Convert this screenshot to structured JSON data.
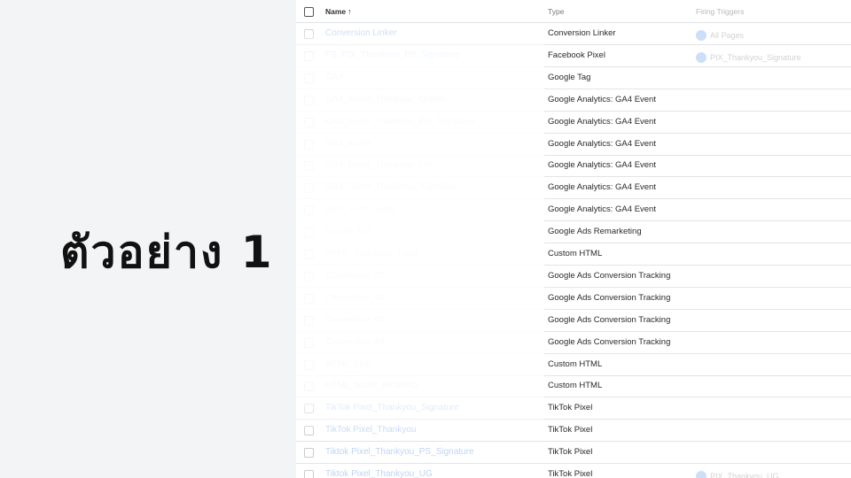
{
  "slide_title": "ตัวอย่าง 1",
  "table": {
    "headers": {
      "name": "Name",
      "sort_icon": "↑",
      "type": "Type",
      "triggers": "Firing Triggers"
    },
    "rows": [
      {
        "name": "Conversion Linker",
        "type": "Conversion Linker",
        "trigger": "All Pages"
      },
      {
        "name": "FB_PIX_Thankyou_PS_Signature",
        "type": "Facebook Pixel",
        "trigger": "PIX_Thankyou_Signature"
      },
      {
        "name": "GA4",
        "type": "Google Tag",
        "trigger": ""
      },
      {
        "name": "GA4_Event_Thankyou_Online",
        "type": "Google Analytics: GA4 Event",
        "trigger": ""
      },
      {
        "name": "GA4_Event_Thankyou_PS_Signature",
        "type": "Google Analytics: GA4 Event",
        "trigger": ""
      },
      {
        "name": "GA4_Event",
        "type": "Google Analytics: GA4 Event",
        "trigger": ""
      },
      {
        "name": "GA4_Event_Thankyou_UG",
        "type": "Google Analytics: GA4 Event",
        "trigger": ""
      },
      {
        "name": "GA4_Event_Thankyou_Signature",
        "type": "Google Analytics: GA4 Event",
        "trigger": ""
      },
      {
        "name": "GA4_Event_Lead",
        "type": "Google Analytics: GA4 Event",
        "trigger": ""
      },
      {
        "name": "Google Ads",
        "type": "Google Ads Remarketing",
        "trigger": ""
      },
      {
        "name": "HTML_Thankyou_Lead",
        "type": "Custom HTML",
        "trigger": ""
      },
      {
        "name": "Conversion_01",
        "type": "Google Ads Conversion Tracking",
        "trigger": ""
      },
      {
        "name": "Conversion_02",
        "type": "Google Ads Conversion Tracking",
        "trigger": ""
      },
      {
        "name": "Conversion_03",
        "type": "Google Ads Conversion Tracking",
        "trigger": ""
      },
      {
        "name": "Conversion_04",
        "type": "Google Ads Conversion Tracking",
        "trigger": ""
      },
      {
        "name": "HTML_Line",
        "type": "Custom HTML",
        "trigger": ""
      },
      {
        "name": "HTML_Script_BK3BRG",
        "type": "Custom HTML",
        "trigger": ""
      },
      {
        "name": "TikTok Pixel_Thankyou_Signature",
        "type": "TikTok Pixel",
        "trigger": ""
      },
      {
        "name": "TikTok Pixel_Thankyou",
        "type": "TikTok Pixel",
        "trigger": ""
      },
      {
        "name": "Tiktok Pixel_Thankyou_PS_Signature",
        "type": "TikTok Pixel",
        "trigger": ""
      },
      {
        "name": "Tiktok Pixel_Thankyou_UG",
        "type": "TikTok Pixel",
        "trigger": "PIX_Thankyou_UG"
      }
    ]
  }
}
